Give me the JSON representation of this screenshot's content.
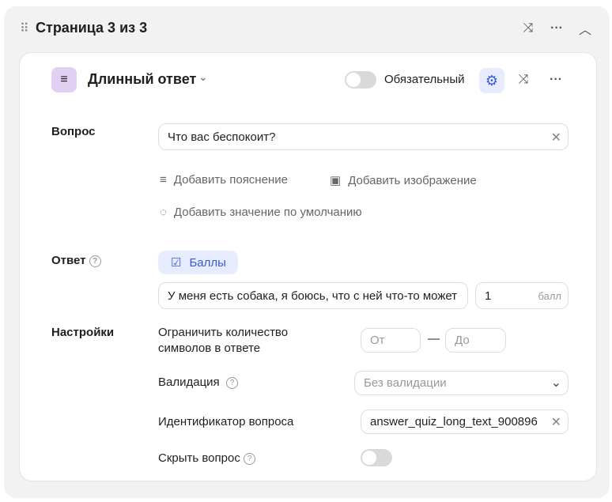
{
  "page": {
    "title": "Страница 3 из 3",
    "icons": [
      "drag-icon",
      "shuffle-icon",
      "more-icon",
      "chevron-up-icon"
    ]
  },
  "question": {
    "type_label": "Длинный ответ",
    "required_label": "Обязательный",
    "required": false,
    "accent": "#e1d0f2",
    "settings_accent": "#e6ecfd",
    "question_label": "Вопрос",
    "question_value": "Что вас беспокоит?",
    "add_description": "Добавить пояснение",
    "add_image": "Добавить изображение",
    "add_default": "Добавить значение по умолчанию",
    "answer_label": "Ответ",
    "points_button": "Баллы",
    "answer_value": "У меня есть собака, я боюсь, что с ней что-то может",
    "points_value": "1",
    "points_unit": "балл",
    "settings_label": "Настройки",
    "limit_label": "Ограничить количество символов в ответе",
    "from_placeholder": "От",
    "dash": "—",
    "to_placeholder": "До",
    "validation_label": "Валидация",
    "validation_value": "Без валидации",
    "id_label": "Идентификатор вопроса",
    "id_value": "answer_quiz_long_text_900896",
    "hide_label": "Скрыть вопрос",
    "hide": false
  }
}
